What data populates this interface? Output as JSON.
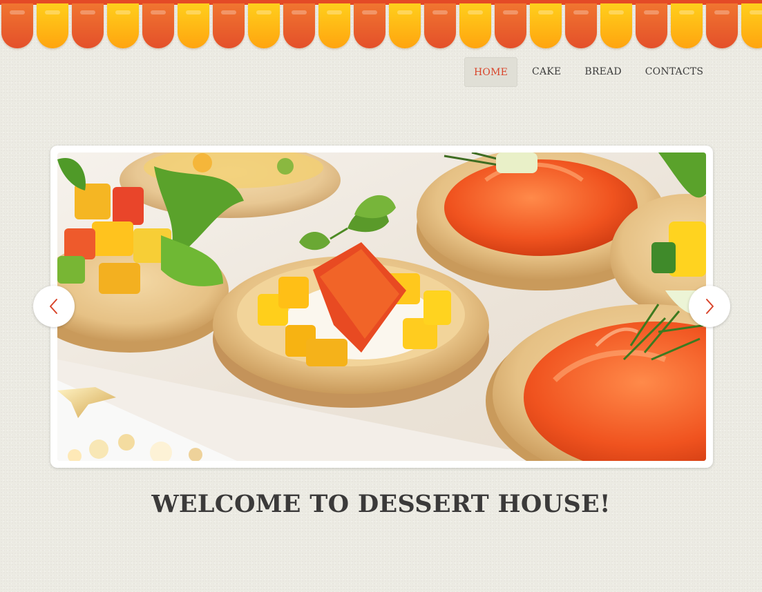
{
  "nav": {
    "items": [
      {
        "label": "HOME",
        "active": true
      },
      {
        "label": "CAKE",
        "active": false
      },
      {
        "label": "BREAD",
        "active": false
      },
      {
        "label": "CONTACTS",
        "active": false
      }
    ]
  },
  "slider": {
    "prev_icon": "chevron-left-icon",
    "next_icon": "chevron-right-icon",
    "image": "canapes-in-pastry-tartlets"
  },
  "welcome": {
    "heading": "WELCOME TO DESSERT HOUSE!"
  },
  "colors": {
    "accent": "#d9452b",
    "awning_red": "#e4502a",
    "awning_yellow": "#ffb511",
    "background": "#ecebe3",
    "text": "#3b3a3a"
  }
}
